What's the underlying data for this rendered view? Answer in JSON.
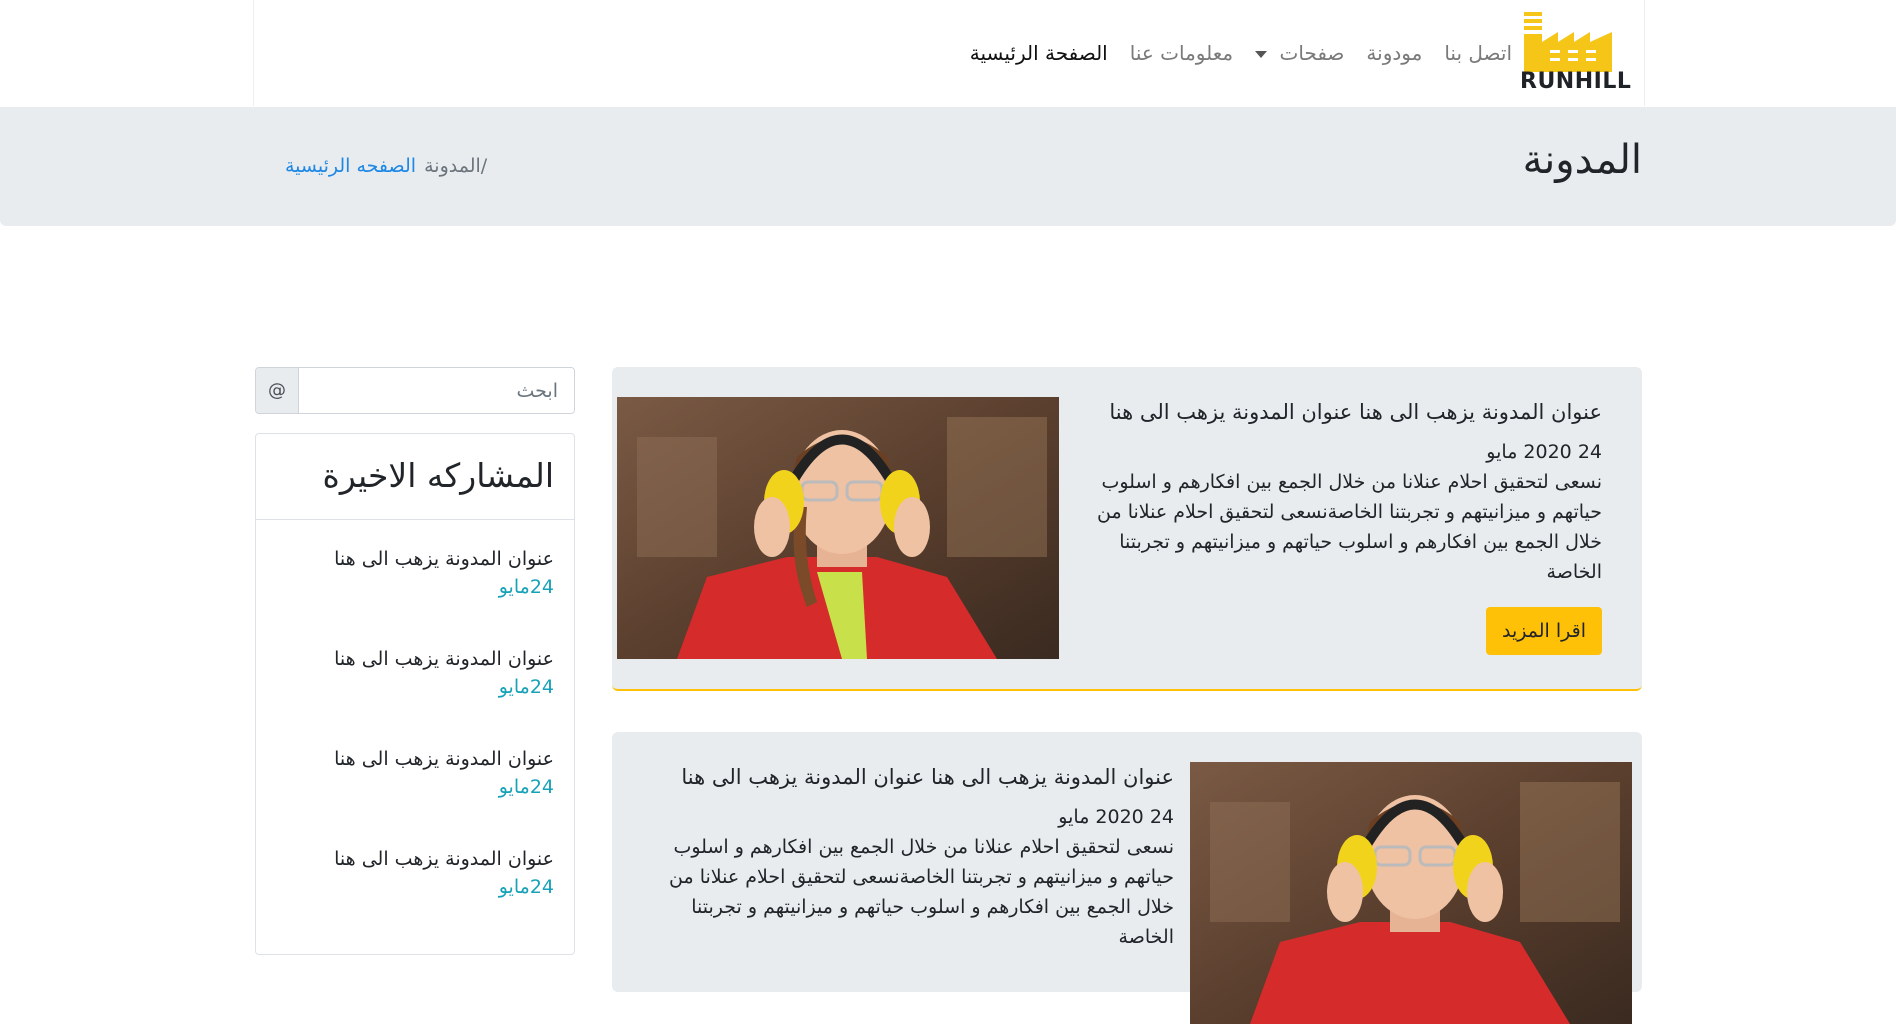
{
  "brand": {
    "logo_text": "RUNHILL"
  },
  "nav": {
    "items": [
      {
        "label": "الصفحة الرئيسية",
        "active": true
      },
      {
        "label": "معلومات عنا"
      },
      {
        "label": "صفحات",
        "dropdown": true
      },
      {
        "label": "مودونة"
      },
      {
        "label": "اتصل بنا"
      }
    ]
  },
  "header": {
    "title": "المدونة",
    "breadcrumb": {
      "home": "الصفحه الرئيسية",
      "separator": "/",
      "current": "المدونة"
    }
  },
  "search": {
    "placeholder": "ابحث",
    "addon": "@"
  },
  "recent": {
    "title": "المشاركه الاخيرة",
    "items": [
      {
        "title": "عنوان المدونة يزهب الى هنا",
        "date": "24مايو"
      },
      {
        "title": "عنوان المدونة يزهب الى هنا",
        "date": "24مايو"
      },
      {
        "title": "عنوان المدونة يزهب الى هنا",
        "date": "24مايو"
      },
      {
        "title": "عنوان المدونة يزهب الى هنا",
        "date": "24مايو"
      }
    ]
  },
  "posts": [
    {
      "title": "عنوان المدونة يزهب الى هنا عنوان المدونة يزهب الى هنا",
      "date": "24 2020 مايو",
      "text": "نسعى لتحقيق احلام عنلانا من خلال الجمع بين افكارهم و اسلوب حياتهم و ميزانيتهم و تجربتنا الخاصةنسعى لتحقيق احلام عنلانا من خلال الجمع بين افكارهم و اسلوب حياتهم و ميزانيتهم و تجربتنا الخاصة",
      "button": "اقرا المزيد"
    },
    {
      "title": "عنوان المدونة يزهب الى هنا عنوان المدونة يزهب الى هنا",
      "date": "24 2020 مايو",
      "text": "نسعى لتحقيق احلام عنلانا من خلال الجمع بين افكارهم و اسلوب حياتهم و ميزانيتهم و تجربتنا الخاصةنسعى لتحقيق احلام عنلانا من خلال الجمع بين افكارهم و اسلوب حياتهم و ميزانيتهم و تجربتنا الخاصة"
    }
  ],
  "colors": {
    "accent": "#ffc107",
    "link": "#1e88e5",
    "band": "#e9ecef",
    "date": "#17a2b8"
  },
  "icons": {
    "logo": "factory-icon",
    "dropdown": "caret-down-icon"
  }
}
